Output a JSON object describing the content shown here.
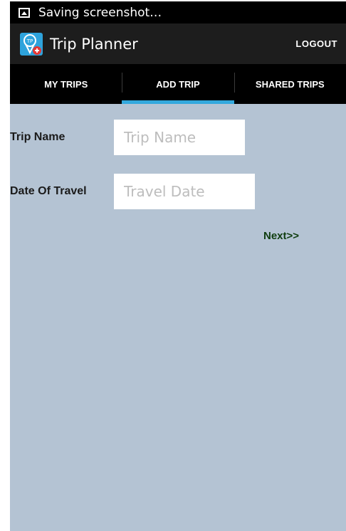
{
  "status_bar": {
    "icon": "screenshot-icon",
    "text": "Saving screenshot…"
  },
  "action_bar": {
    "logo_icon": "trip-planner-logo-icon",
    "title": "Trip Planner",
    "logout_label": "LOGOUT"
  },
  "tabs": [
    {
      "label": "MY TRIPS",
      "active": false
    },
    {
      "label": "ADD TRIP",
      "active": true
    },
    {
      "label": "SHARED TRIPS",
      "active": false
    }
  ],
  "form": {
    "trip_name": {
      "label": "Trip Name",
      "value": "",
      "placeholder": "Trip Name"
    },
    "date_of_travel": {
      "label": "Date Of Travel",
      "value": "",
      "placeholder": "Travel Date"
    },
    "next_label": "Next>>"
  },
  "colors": {
    "background": "#b4c3d3",
    "tab_indicator": "#33a8dd",
    "next_link": "#0f3d0f",
    "action_bar": "#1d1d1d"
  }
}
